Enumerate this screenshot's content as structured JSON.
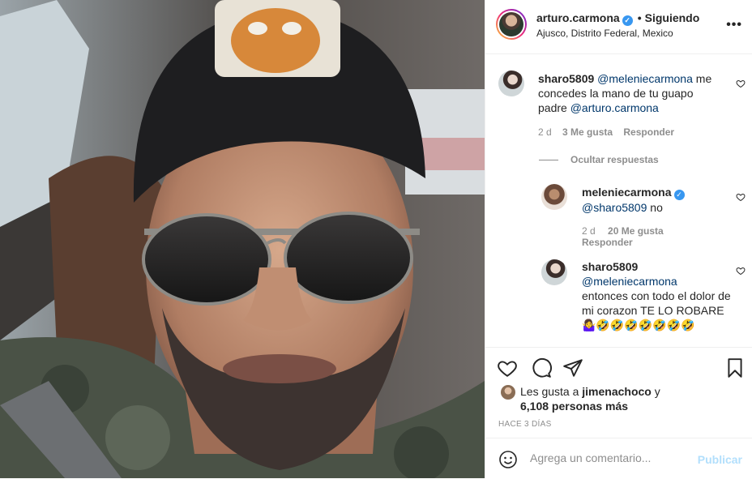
{
  "post": {
    "username": "arturo.carmona",
    "follow_separator": "•",
    "follow_status": "Siguiendo",
    "location": "Ajusco, Distrito Federal, Mexico",
    "more": "•••"
  },
  "comments": [
    {
      "user": "sharo5809",
      "mention1": "@meleniecarmona",
      "text1": " me concedes la mano de tu guapo padre ",
      "mention2": "@arturo.carmona",
      "age": "2 d",
      "likes": "3 Me gusta",
      "reply": "Responder"
    }
  ],
  "hide_replies": "Ocultar respuestas",
  "replies": [
    {
      "user": "meleniecarmona",
      "mention": "@sharo5809",
      "text": " no",
      "age": "2 d",
      "likes": "20 Me gusta",
      "reply": "Responder"
    },
    {
      "user": "sharo5809",
      "mention": "@meleniecarmona",
      "text": "entonces con todo el dolor de mi corazon TE LO ROBARE 🤷‍♀️🤣🤣🤣🤣🤣🤣🤣"
    }
  ],
  "likes": {
    "prefix": "Les gusta a ",
    "user": "jimenachoco",
    "suffix": " y",
    "others": "6,108 personas más"
  },
  "time_ago": "HACE 3 DÍAS",
  "add_comment": {
    "placeholder": "Agrega un comentario...",
    "publish": "Publicar"
  },
  "colors": {
    "verified": "#3897f0",
    "mention": "#00376b",
    "muted": "#8e8e8e",
    "publish_disabled": "#b2dffc"
  }
}
